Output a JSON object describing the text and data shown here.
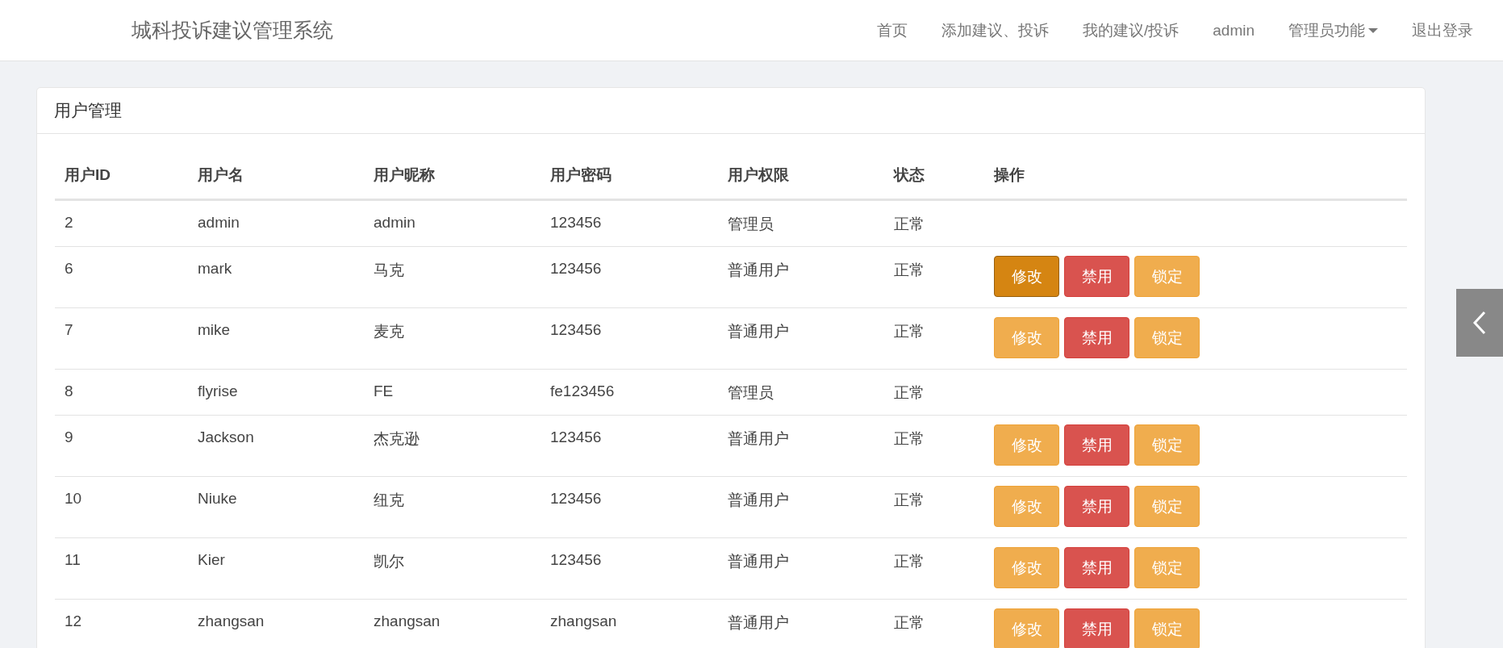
{
  "navbar": {
    "brand": "城科投诉建议管理系统",
    "links": [
      {
        "label": "首页",
        "dropdown": false
      },
      {
        "label": "添加建议、投诉",
        "dropdown": false
      },
      {
        "label": "我的建议/投诉",
        "dropdown": false
      },
      {
        "label": "admin",
        "dropdown": false
      },
      {
        "label": "管理员功能",
        "dropdown": true
      },
      {
        "label": "退出登录",
        "dropdown": false
      }
    ]
  },
  "panel": {
    "title": "用户管理"
  },
  "table": {
    "columns": [
      "用户ID",
      "用户名",
      "用户昵称",
      "用户密码",
      "用户权限",
      "状态",
      "操作"
    ],
    "rows": [
      {
        "cells": [
          "2",
          "admin",
          "admin",
          "123456",
          "管理员",
          "正常"
        ],
        "actions": []
      },
      {
        "cells": [
          "6",
          "mark",
          "马克",
          "123456",
          "普通用户",
          "正常"
        ],
        "actions": [
          {
            "label": "修改",
            "kind": "warning",
            "hovered": true
          },
          {
            "label": "禁用",
            "kind": "danger",
            "hovered": false
          },
          {
            "label": "锁定",
            "kind": "warning",
            "hovered": false
          }
        ]
      },
      {
        "cells": [
          "7",
          "mike",
          "麦克",
          "123456",
          "普通用户",
          "正常"
        ],
        "actions": [
          {
            "label": "修改",
            "kind": "warning",
            "hovered": false
          },
          {
            "label": "禁用",
            "kind": "danger",
            "hovered": false
          },
          {
            "label": "锁定",
            "kind": "warning",
            "hovered": false
          }
        ]
      },
      {
        "cells": [
          "8",
          "flyrise",
          "FE",
          "fe123456",
          "管理员",
          "正常"
        ],
        "actions": []
      },
      {
        "cells": [
          "9",
          "Jackson",
          "杰克逊",
          "123456",
          "普通用户",
          "正常"
        ],
        "actions": [
          {
            "label": "修改",
            "kind": "warning",
            "hovered": false
          },
          {
            "label": "禁用",
            "kind": "danger",
            "hovered": false
          },
          {
            "label": "锁定",
            "kind": "warning",
            "hovered": false
          }
        ]
      },
      {
        "cells": [
          "10",
          "Niuke",
          "纽克",
          "123456",
          "普通用户",
          "正常"
        ],
        "actions": [
          {
            "label": "修改",
            "kind": "warning",
            "hovered": false
          },
          {
            "label": "禁用",
            "kind": "danger",
            "hovered": false
          },
          {
            "label": "锁定",
            "kind": "warning",
            "hovered": false
          }
        ]
      },
      {
        "cells": [
          "11",
          "Kier",
          "凯尔",
          "123456",
          "普通用户",
          "正常"
        ],
        "actions": [
          {
            "label": "修改",
            "kind": "warning",
            "hovered": false
          },
          {
            "label": "禁用",
            "kind": "danger",
            "hovered": false
          },
          {
            "label": "锁定",
            "kind": "warning",
            "hovered": false
          }
        ]
      },
      {
        "cells": [
          "12",
          "zhangsan",
          "zhangsan",
          "zhangsan",
          "普通用户",
          "正常"
        ],
        "actions": [
          {
            "label": "修改",
            "kind": "warning",
            "hovered": false
          },
          {
            "label": "禁用",
            "kind": "danger",
            "hovered": false
          },
          {
            "label": "锁定",
            "kind": "warning",
            "hovered": false
          }
        ]
      }
    ]
  }
}
